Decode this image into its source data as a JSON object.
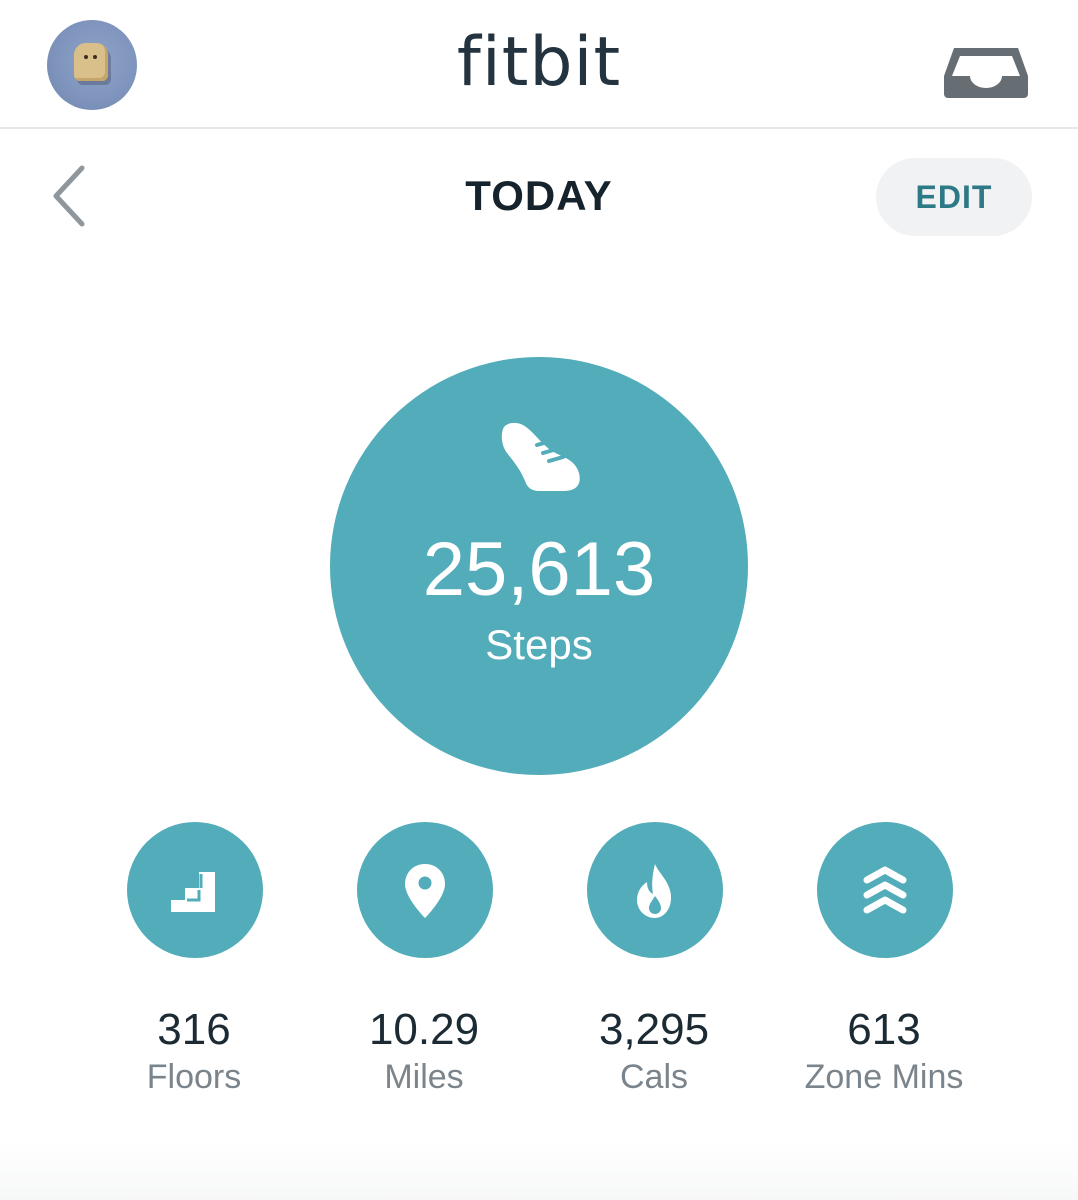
{
  "app_bar": {
    "brand": "fitbit",
    "avatar_icon": "toast-avatar-icon",
    "inbox_icon": "inbox-icon"
  },
  "header": {
    "back_icon": "chevron-left-icon",
    "title": "TODAY",
    "edit_label": "EDIT"
  },
  "steps": {
    "icon": "shoe-icon",
    "value": "25,613",
    "label": "Steps"
  },
  "stats": [
    {
      "icon": "stairs-icon",
      "value": "316",
      "label": "Floors"
    },
    {
      "icon": "location-pin-icon",
      "value": "10.29",
      "label": "Miles"
    },
    {
      "icon": "flame-icon",
      "value": "3,295",
      "label": "Cals"
    },
    {
      "icon": "chevrons-up-icon",
      "value": "613",
      "label": "Zone Mins"
    }
  ],
  "colors": {
    "accent": "#52acb9",
    "edit_text": "#2d7a86",
    "title_text": "#16232c",
    "label_text": "#7b848b"
  }
}
